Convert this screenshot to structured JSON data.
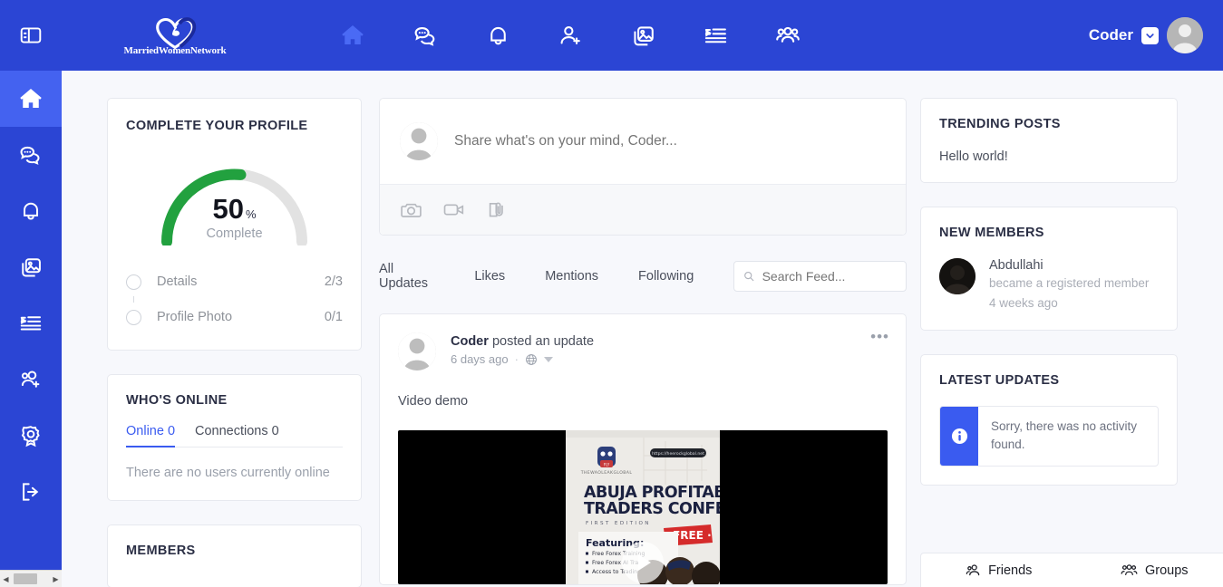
{
  "brand": {
    "name": "MarriedWomenNetwork",
    "accent": "#2b45d4",
    "accent_light": "#4462f0",
    "link_blue": "#3a5bf0",
    "green": "#22a13f"
  },
  "rail": {
    "toggle_icon": "panel-toggle-icon",
    "items": [
      {
        "icon": "home-icon",
        "name": "home",
        "active": true
      },
      {
        "icon": "messages-icon",
        "name": "messages",
        "active": false
      },
      {
        "icon": "notifications-icon",
        "name": "notifications",
        "active": false
      },
      {
        "icon": "photos-icon",
        "name": "photos",
        "active": false
      },
      {
        "icon": "playlist-icon",
        "name": "videos",
        "active": false
      },
      {
        "icon": "members-add-icon",
        "name": "members",
        "active": false
      },
      {
        "icon": "badge-icon",
        "name": "badges",
        "active": false
      },
      {
        "icon": "logout-icon",
        "name": "logout",
        "active": false
      }
    ]
  },
  "header": {
    "logo_text": "MarriedWomenNetwork",
    "nav": [
      {
        "icon": "home-icon",
        "name": "home",
        "active": true
      },
      {
        "icon": "messages-icon",
        "name": "messages",
        "active": false
      },
      {
        "icon": "notifications-icon",
        "name": "notifications",
        "active": false
      },
      {
        "icon": "friend-request-icon",
        "name": "friend-requests",
        "active": false
      },
      {
        "icon": "photos-icon",
        "name": "photos",
        "active": false
      },
      {
        "icon": "playlist-icon",
        "name": "videos",
        "active": false
      },
      {
        "icon": "groups-icon",
        "name": "groups",
        "active": false
      }
    ],
    "user_name": "Coder",
    "caret_icon": "chevron-down-icon",
    "avatar_icon": "user-avatar"
  },
  "profile_card": {
    "title": "COMPLETE YOUR PROFILE",
    "percent": "50",
    "percent_symbol": "%",
    "complete_label": "Complete",
    "steps": [
      {
        "label": "Details",
        "count": "2/3"
      },
      {
        "label": "Profile Photo",
        "count": "0/1"
      }
    ]
  },
  "online_card": {
    "title": "WHO'S ONLINE",
    "tabs": [
      {
        "label": "Online 0",
        "active": true
      },
      {
        "label": "Connections 0",
        "active": false
      }
    ],
    "empty_text": "There are no users currently online"
  },
  "members_card": {
    "title": "MEMBERS"
  },
  "composer": {
    "placeholder": "Share what's on your mind, Coder...",
    "value": "",
    "actions": [
      {
        "icon": "camera-icon",
        "name": "add-photo"
      },
      {
        "icon": "video-icon",
        "name": "add-video"
      },
      {
        "icon": "attachment-icon",
        "name": "add-attachment"
      }
    ]
  },
  "feed": {
    "tabs": [
      {
        "label": "All Updates",
        "active": true
      },
      {
        "label": "Likes",
        "active": false
      },
      {
        "label": "Mentions",
        "active": false
      },
      {
        "label": "Following",
        "active": false
      }
    ],
    "search_placeholder": "Search Feed...",
    "search_value": "",
    "search_icon": "search-icon"
  },
  "post": {
    "author": "Coder",
    "action": "posted an update",
    "time": "6 days ago",
    "separator": "·",
    "privacy_icon": "globe-icon",
    "privacy_caret": "caret-down-icon",
    "more_icon": "ellipsis-icon",
    "text": "Video demo",
    "video": {
      "play_icon": "play-icon",
      "poster_brand": "THEWAOLEAKGLOBAL",
      "poster_url": "https://heerockglobal.net",
      "poster_title_1": "ABUJA PROFITABLE",
      "poster_title_2": "TRADERS CONFERENCE",
      "poster_edition": "F I R S T   E D I T I O N",
      "poster_badge": "FREE",
      "poster_featuring": "Featuring:",
      "poster_bullets": [
        "Free Forex Training",
        "Free Forex AI Training",
        "Access to Trading"
      ]
    }
  },
  "trending": {
    "title": "TRENDING POSTS",
    "items": [
      "Hello world!"
    ]
  },
  "new_members": {
    "title": "NEW MEMBERS",
    "items": [
      {
        "name": "Abdullahi",
        "action": "became a registered member",
        "time": "4 weeks ago"
      }
    ]
  },
  "latest_updates": {
    "title": "LATEST UPDATES",
    "alert_icon": "info-icon",
    "alert_text": "Sorry, there was no activity found."
  },
  "bottom_bar": {
    "items": [
      {
        "label": "Friends",
        "icon": "friends-icon"
      },
      {
        "label": "Groups",
        "icon": "groups-icon"
      }
    ]
  },
  "scrollbar": {
    "left_arrow": "◀",
    "right_arrow": "▶"
  }
}
